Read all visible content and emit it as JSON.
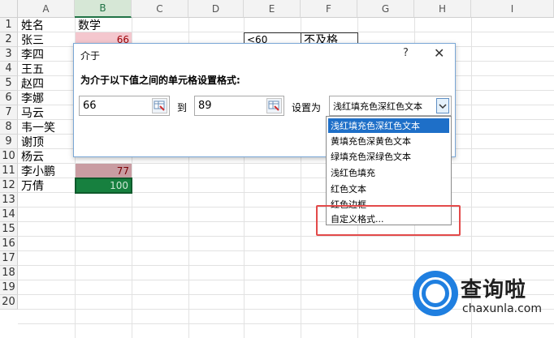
{
  "columns": [
    "A",
    "B",
    "C",
    "D",
    "E",
    "F",
    "G",
    "H",
    "I"
  ],
  "rows": [
    "1",
    "2",
    "3",
    "4",
    "5",
    "6",
    "7",
    "8",
    "9",
    "10",
    "11",
    "12",
    "13",
    "14",
    "15",
    "16",
    "17",
    "18",
    "19",
    "20"
  ],
  "cells": {
    "a1": "姓名",
    "b1": "数学",
    "a2": "张三",
    "b2": "66",
    "a3": "李四",
    "a4": "王五",
    "a5": "赵四",
    "a6": "李娜",
    "a7": "马云",
    "a8": "韦一笑",
    "a9": "谢顶",
    "a10": "杨云",
    "a11": "李小鹏",
    "b11": "77",
    "a12": "万倩",
    "b12": "100",
    "e2": "<60",
    "f2": "不及格"
  },
  "colors": {
    "light_red_fill": "#f4c7ce",
    "dark_red_text": "#9c0006",
    "muted_red_fill": "#c99ca2",
    "green_fill": "#17803f",
    "accent_blue": "#1e6fc8",
    "highlight_box": "#e34a4a"
  },
  "dialog": {
    "title": "介于",
    "help": "?",
    "close": "✕",
    "prompt": "为介于以下值之间的单元格设置格式:",
    "from_value": "66",
    "to_label": "到",
    "to_value": "89",
    "set_label": "设置为",
    "selected_format": "浅红填充色深红色文本",
    "range_button_icon": "range-select-icon",
    "dropdown_arrow_icon": "chevron-down-icon"
  },
  "dropdown": {
    "options": [
      "浅红填充色深红色文本",
      "黄填充色深黄色文本",
      "绿填充色深绿色文本",
      "浅红色填充",
      "红色文本",
      "红色边框",
      "自定义格式..."
    ],
    "highlighted_index": 0
  },
  "watermark": {
    "brand": "查询啦",
    "url": "chaxunla.com"
  }
}
